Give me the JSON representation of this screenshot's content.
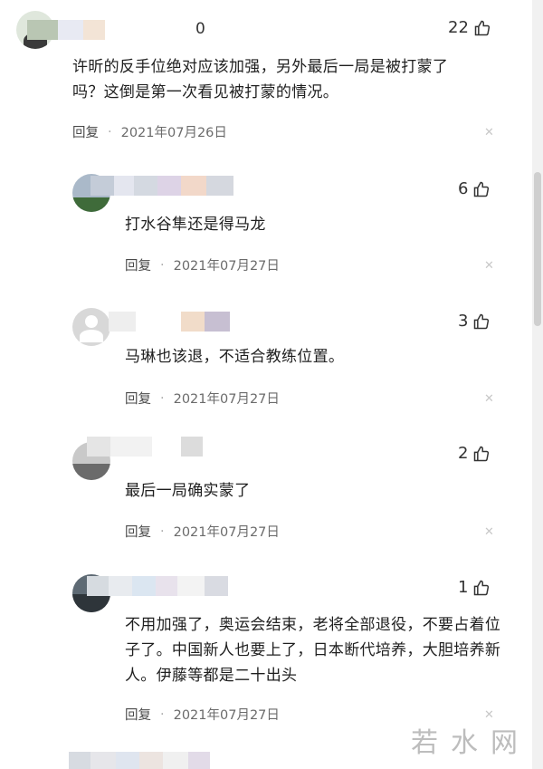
{
  "comments": [
    {
      "name_suffix": "0",
      "likes": "22",
      "text": "许昕的反手位绝对应该加强，另外最后一局是被打蒙了吗？这倒是第一次看见被打蒙的情况。",
      "reply_label": "回复",
      "date": "2021年07月26日"
    },
    {
      "likes": "6",
      "text": "打水谷隼还是得马龙",
      "reply_label": "回复",
      "date": "2021年07月27日"
    },
    {
      "likes": "3",
      "text": "马琳也该退，不适合教练位置。",
      "reply_label": "回复",
      "date": "2021年07月27日"
    },
    {
      "likes": "2",
      "text": "最后一局确实蒙了",
      "reply_label": "回复",
      "date": "2021年07月27日"
    },
    {
      "likes": "1",
      "text": "不用加强了，奥运会结束，老将全部退役，不要占着位子了。中国新人也要上了，日本断代培养，大胆培养新人。伊藤等都是二十出头",
      "reply_label": "回复",
      "date": "2021年07月27日"
    }
  ],
  "watermark": "若水网",
  "colors": {
    "text": "#1f1f1f",
    "meta": "#6b6b6b",
    "background": "#ffffff"
  }
}
